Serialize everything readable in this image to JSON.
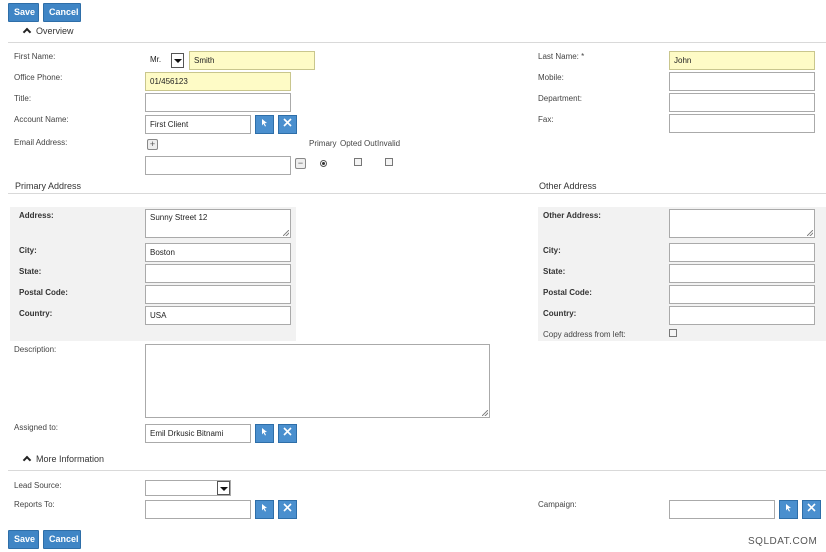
{
  "toolbar": {
    "save_label": "Save",
    "cancel_label": "Cancel"
  },
  "overview": {
    "title": "Overview",
    "first_name_label": "First Name:",
    "salutation_value": "Mr.",
    "first_name_value": "Smith",
    "last_name_label": "Last Name: *",
    "last_name_value": "John",
    "office_phone_label": "Office Phone:",
    "office_phone_value": "01/456123",
    "mobile_label": "Mobile:",
    "title_label": "Title:",
    "department_label": "Department:",
    "account_name_label": "Account Name:",
    "account_name_value": "First Client",
    "fax_label": "Fax:",
    "email_label": "Email Address:",
    "email_primary_label": "Primary",
    "email_opted_out_label": "Opted Out",
    "email_invalid_label": "Invalid"
  },
  "primary_address": {
    "title": "Primary Address",
    "address_label": "Address:",
    "address_value": "Sunny Street 12",
    "city_label": "City:",
    "city_value": "Boston",
    "state_label": "State:",
    "postal_label": "Postal Code:",
    "country_label": "Country:",
    "country_value": "USA"
  },
  "other_address": {
    "title": "Other Address",
    "address_label": "Other Address:",
    "city_label": "City:",
    "state_label": "State:",
    "postal_label": "Postal Code:",
    "country_label": "Country:",
    "copy_label": "Copy address from left:"
  },
  "description_label": "Description:",
  "assigned_to_label": "Assigned to:",
  "assigned_to_value": "Emil Drkusic Bitnami",
  "more_info": {
    "title": "More Information",
    "lead_source_label": "Lead Source:",
    "reports_to_label": "Reports To:",
    "campaign_label": "Campaign:"
  },
  "icons": {
    "select": "select-arrow-icon",
    "clear": "clear-x-icon",
    "add": "plus-icon",
    "remove": "minus-icon",
    "collapse": "chevron-up-icon"
  },
  "colors": {
    "button": "#3f85c5",
    "required_field": "#fefbc6",
    "panel_bg": "#f2f2f2"
  },
  "watermark": "SQLDAT.COM"
}
